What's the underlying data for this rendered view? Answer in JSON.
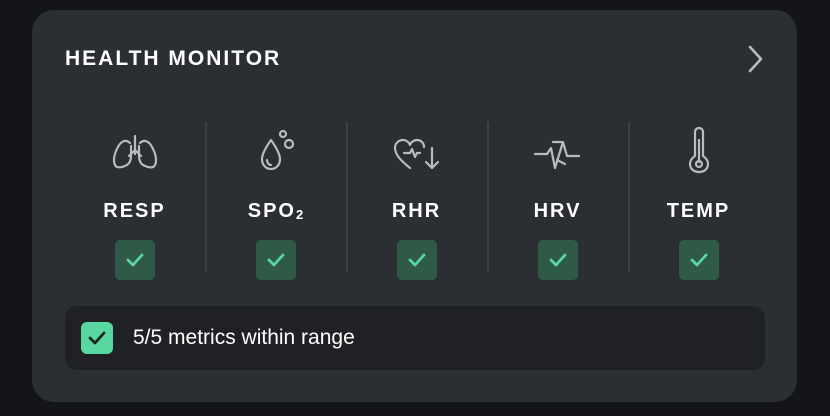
{
  "header": {
    "title": "HEALTH MONITOR",
    "chevron_icon": "chevron-right-icon"
  },
  "metrics": [
    {
      "label": "RESP",
      "icon": "lungs-icon",
      "status": "ok"
    },
    {
      "label": "SPO",
      "sub": "2",
      "icon": "droplet-icon",
      "status": "ok"
    },
    {
      "label": "RHR",
      "icon": "heart-down-icon",
      "status": "ok"
    },
    {
      "label": "HRV",
      "icon": "heartbeat-line-icon",
      "status": "ok"
    },
    {
      "label": "TEMP",
      "icon": "thermometer-icon",
      "status": "ok"
    }
  ],
  "summary": {
    "text": "5/5 metrics within range",
    "icon": "check-icon"
  },
  "colors": {
    "background": "#131518",
    "card": "#2b2e32",
    "summary_bg": "#1f2124",
    "check_bg": "#2f5a48",
    "check_mark": "#58d8a0",
    "summary_check_bg": "#58d8a0",
    "icon_stroke": "#b9bcbf",
    "text": "#ffffff"
  }
}
